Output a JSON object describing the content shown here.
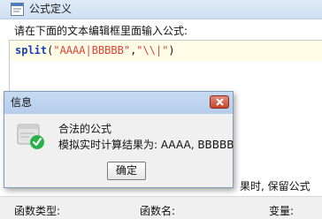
{
  "window": {
    "title": "公式定义",
    "instruction": "请在下面的文本编辑框里面输入公式:"
  },
  "formula": {
    "function": "split",
    "open_paren": "(",
    "arg1": "\"AAAA|BBBBB\"",
    "comma": ",",
    "arg2": "\"\\\\|\"",
    "close_paren": ")"
  },
  "background": {
    "hint_right": "果时, 保留公式",
    "columns": {
      "func_type": "函数类型:",
      "func_name": "函数名:",
      "variable": "变量:"
    }
  },
  "dialog": {
    "title": "信息",
    "message_title": "合法的公式",
    "message_result": "模拟实时计算结果为: AAAA, BBBBB",
    "ok_label": "确定",
    "icon": "success-check-icon"
  },
  "colors": {
    "formula_function": "#1a3fb5",
    "formula_string": "#e0413a",
    "formula_background": "#fffde6",
    "close_button": "#c8442c",
    "success": "#2bb14a"
  }
}
